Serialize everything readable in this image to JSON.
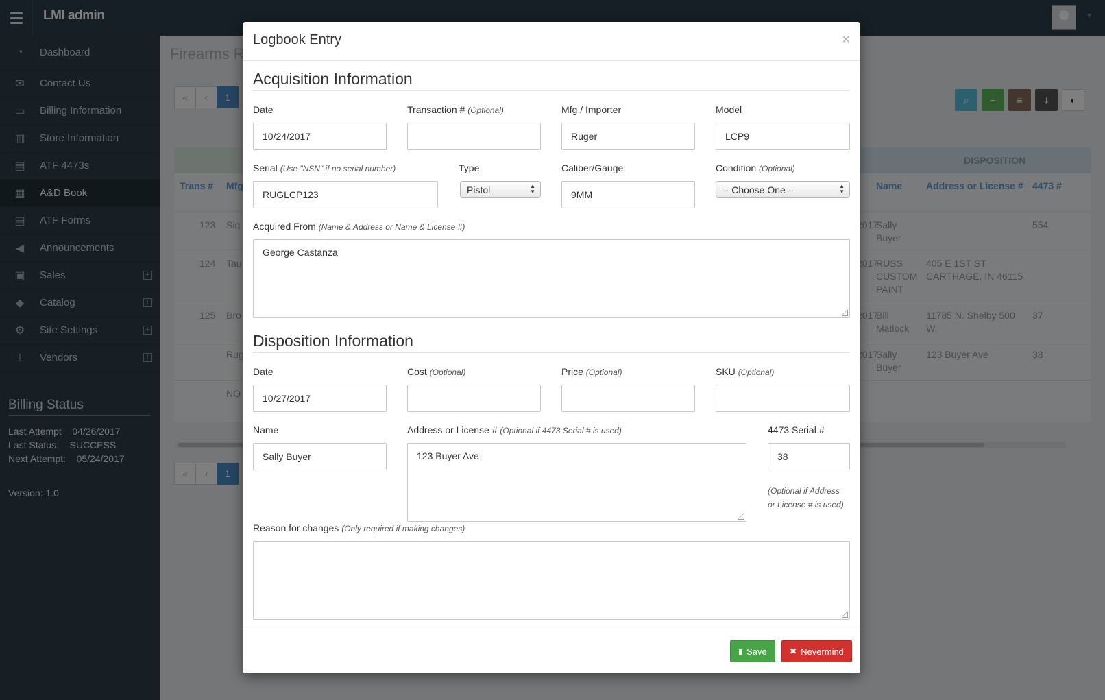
{
  "app": {
    "brand": "LMI admin",
    "page_title": "Firearms R",
    "nav": [
      {
        "label": "Dashboard",
        "icon": "dashboard-icon"
      },
      {
        "label": "Contact Us",
        "icon": "envelope-icon"
      },
      {
        "label": "Billing Information",
        "icon": "credit-card-icon"
      },
      {
        "label": "Store Information",
        "icon": "building-icon"
      },
      {
        "label": "ATF 4473s",
        "icon": "document-icon"
      },
      {
        "label": "A&D Book",
        "icon": "book-icon"
      },
      {
        "label": "ATF Forms",
        "icon": "document-icon"
      },
      {
        "label": "Announcements",
        "icon": "bullhorn-icon"
      },
      {
        "label": "Sales",
        "icon": "money-icon"
      },
      {
        "label": "Catalog",
        "icon": "tags-icon"
      },
      {
        "label": "Site Settings",
        "icon": "cogs-icon"
      },
      {
        "label": "Vendors",
        "icon": "sitemap-icon"
      }
    ],
    "billing": {
      "heading": "Billing Status",
      "last_attempt": "Last Attempt    04/26/2017",
      "last_status": "Last Status:    SUCCESS",
      "next_attempt": "Next Attempt:    05/24/2017",
      "version": "Version: 1.0"
    },
    "pager": {
      "first": "«",
      "prev": "‹",
      "current": "1"
    },
    "table": {
      "disposition_header": "DISPOSITION",
      "headers_left": [
        "Trans #",
        "Mfg"
      ],
      "headers_right": [
        "Name",
        "Address or License #",
        "4473 #"
      ],
      "rows": [
        {
          "trans": "123",
          "mfg": "Sig",
          "date": "2017",
          "name": "Sally Buyer",
          "address": "",
          "serial": "554"
        },
        {
          "trans": "124",
          "mfg": "Tau",
          "date": "2017",
          "name": "RUSS CUSTOM PAINT",
          "address": "405 E 1ST ST CARTHAGE, IN 46115",
          "serial": ""
        },
        {
          "trans": "125",
          "mfg": "Bro",
          "date": "2017",
          "name": "Bill Matlock",
          "address": "11785 N. Shelby 500 W.",
          "serial": "37"
        },
        {
          "trans": "",
          "mfg": "Rug",
          "date": "2017",
          "name": "Sally Buyer",
          "address": "123 Buyer Ave",
          "serial": "38"
        },
        {
          "trans": "",
          "mfg": "NO",
          "date": "",
          "name": "",
          "address": "",
          "serial": ""
        }
      ]
    }
  },
  "modal": {
    "title": "Logbook Entry",
    "close": "×",
    "acquisition": {
      "heading": "Acquisition Information",
      "date_label": "Date",
      "date_value": "10/24/2017",
      "transaction_label": "Transaction #",
      "transaction_hint": "(Optional)",
      "transaction_value": "",
      "mfg_label": "Mfg / Importer",
      "mfg_value": "Ruger",
      "model_label": "Model",
      "model_value": "LCP9",
      "serial_label": "Serial",
      "serial_hint": "(Use \"NSN\" if no serial number)",
      "serial_value": "RUGLCP123",
      "type_label": "Type",
      "type_value": "Pistol",
      "caliber_label": "Caliber/Gauge",
      "caliber_value": "9MM",
      "condition_label": "Condition",
      "condition_hint": "(Optional)",
      "condition_value": "-- Choose One --",
      "acquired_label": "Acquired From",
      "acquired_hint": "(Name & Address or Name & License #)",
      "acquired_value": "George Castanza"
    },
    "disposition": {
      "heading": "Disposition Information",
      "date_label": "Date",
      "date_value": "10/27/2017",
      "cost_label": "Cost",
      "cost_hint": "(Optional)",
      "cost_value": "",
      "price_label": "Price",
      "price_hint": "(Optional)",
      "price_value": "",
      "sku_label": "SKU",
      "sku_hint": "(Optional)",
      "sku_value": "",
      "name_label": "Name",
      "name_value": "Sally Buyer",
      "address_label": "Address or License #",
      "address_hint": "(Optional if 4473 Serial # is used)",
      "address_value": "123 Buyer Ave",
      "serial4473_label": "4473 Serial #",
      "serial4473_value": "38",
      "serial4473_hint_1": "(Optional if Address",
      "serial4473_hint_2": "or License # is used)",
      "reason_label": "Reason for changes",
      "reason_hint": "(Only required if making changes)",
      "reason_value": ""
    },
    "footer": {
      "save": "Save",
      "nevermind": "Nevermind"
    }
  },
  "colors": {
    "save": "#47a447",
    "nevermind": "#d2322d",
    "link": "#5d9ed6"
  }
}
